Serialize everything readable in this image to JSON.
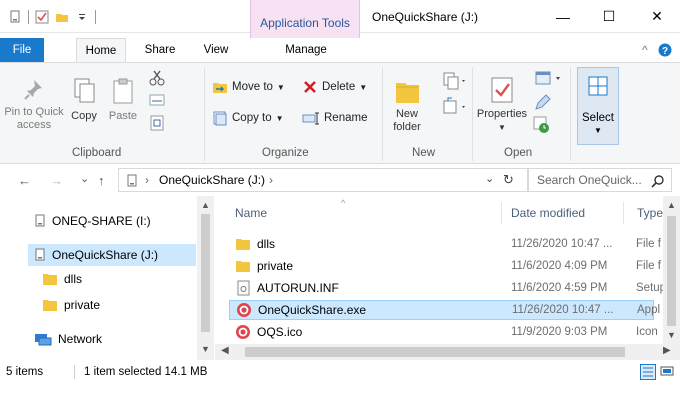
{
  "titlebar": {
    "context_tab_group": "Application Tools",
    "window_title": "OneQuickShare (J:)",
    "minimize": "—",
    "maximize": "☐",
    "close": "✕"
  },
  "ribbon_tabs": {
    "file": "File",
    "home": "Home",
    "share": "Share",
    "view": "View",
    "manage": "Manage",
    "collapse": "^",
    "help": "?"
  },
  "clipboard": {
    "pin": "Pin to Quick access",
    "copy": "Copy",
    "paste": "Paste",
    "label": "Clipboard"
  },
  "organize": {
    "move_to": "Move to",
    "copy_to": "Copy to",
    "delete": "Delete",
    "rename": "Rename",
    "label": "Organize"
  },
  "new_group": {
    "new_folder": "New folder",
    "label": "New"
  },
  "open_group": {
    "properties": "Properties",
    "label": "Open"
  },
  "select_group": {
    "select": "Select"
  },
  "address": {
    "back": "←",
    "forward": "→",
    "recent": "⌄",
    "up": "↑",
    "path": "OneQuickShare (J:)",
    "path_chevron": "›",
    "refresh": "↻",
    "search_placeholder": "Search OneQuick..."
  },
  "navpane": {
    "items": [
      {
        "label": "ONEQ-SHARE (I:)"
      },
      {
        "label": "OneQuickShare (J:)"
      },
      {
        "label": "dlls"
      },
      {
        "label": "private"
      },
      {
        "label": "Network"
      }
    ]
  },
  "filelist": {
    "columns": {
      "name": "Name",
      "date": "Date modified",
      "type": "Type"
    },
    "rows": [
      {
        "name": "dlls",
        "date": "11/26/2020 10:47 ...",
        "type": "File f",
        "icon": "folder-icon"
      },
      {
        "name": "private",
        "date": "11/6/2020 4:09 PM",
        "type": "File f",
        "icon": "folder-icon"
      },
      {
        "name": "AUTORUN.INF",
        "date": "11/6/2020 4:59 PM",
        "type": "Setup",
        "icon": "setup-file-icon"
      },
      {
        "name": "OneQuickShare.exe",
        "date": "11/26/2020 10:47 ...",
        "type": "Appl",
        "icon": "app-icon"
      },
      {
        "name": "OQS.ico",
        "date": "11/9/2020 9:03 PM",
        "type": "Icon",
        "icon": "app-icon"
      }
    ]
  },
  "status": {
    "count": "5 items",
    "selection": "1 item selected 14.1 MB"
  },
  "colors": {
    "file_tab": "#1979ca",
    "selection": "#cce8ff",
    "context_tab": "#f6e2f3",
    "app_icon": "#e0454f"
  }
}
